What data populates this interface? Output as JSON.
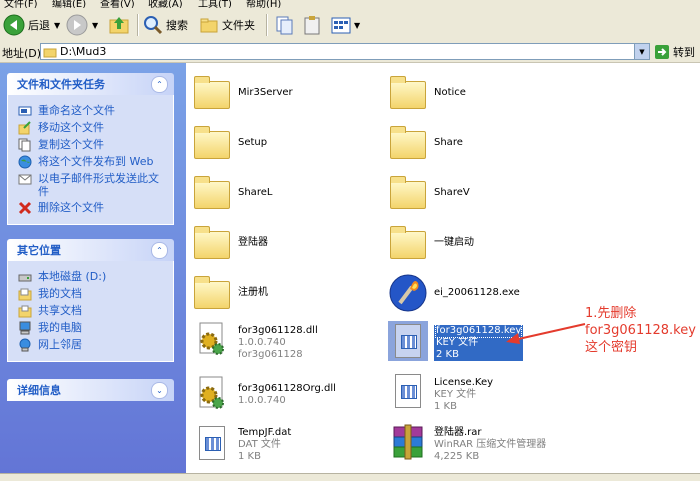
{
  "menubar": {
    "items": [
      "文件(F)",
      "编辑(E)",
      "查看(V)",
      "收藏(A)",
      "工具(T)",
      "帮助(H)"
    ]
  },
  "toolbar": {
    "back_label": "后退",
    "search_label": "搜索",
    "folders_label": "文件夹"
  },
  "address": {
    "label": "地址(D)",
    "value": "D:\\Mud3",
    "go_label": "转到"
  },
  "sidebar": {
    "tasks": {
      "title": "文件和文件夹任务",
      "items": [
        "重命名这个文件",
        "移动这个文件",
        "复制这个文件",
        "将这个文件发布到 Web",
        "以电子邮件形式发送此文件",
        "删除这个文件"
      ]
    },
    "places": {
      "title": "其它位置",
      "items": [
        "本地磁盘 (D:)",
        "我的文档",
        "共享文档",
        "我的电脑",
        "网上邻居"
      ]
    },
    "details": {
      "title": "详细信息"
    }
  },
  "files": [
    {
      "name": "Mir3Server",
      "type": "folder"
    },
    {
      "name": "Notice",
      "type": "folder"
    },
    {
      "name": "Setup",
      "type": "folder"
    },
    {
      "name": "Share",
      "type": "folder"
    },
    {
      "name": "ShareL",
      "type": "folder"
    },
    {
      "name": "ShareV",
      "type": "folder"
    },
    {
      "name": "登陆器",
      "type": "folder"
    },
    {
      "name": "一键启动",
      "type": "folder"
    },
    {
      "name": "注册机",
      "type": "folder"
    },
    {
      "name": "ei_20061128.exe",
      "type": "exe"
    },
    {
      "name": "for3g061128.dll",
      "line2": "1.0.0.740",
      "line3": "for3g061128",
      "type": "dll"
    },
    {
      "name": "for3g061128.key",
      "line2": "KEY 文件",
      "line3": "2 KB",
      "type": "key",
      "selected": true
    },
    {
      "name": "for3g061128Org.dll",
      "line2": "1.0.0.740",
      "type": "dll"
    },
    {
      "name": "License.Key",
      "line2": "KEY 文件",
      "line3": "1 KB",
      "type": "key"
    },
    {
      "name": "TempJF.dat",
      "line2": "DAT 文件",
      "line3": "1 KB",
      "type": "dat"
    },
    {
      "name": "登陆器.rar",
      "line2": "WinRAR 压缩文件管理器",
      "line3": "4,225 KB",
      "type": "rar"
    }
  ],
  "annotation": {
    "lines": [
      "1.先删除",
      "for3g061128.key",
      "这个密钥"
    ],
    "color": "#e43b2d"
  },
  "colors": {
    "sidebar_top": "#7ba2e7",
    "sidebar_bottom": "#6375d6",
    "selection": "#316ac5",
    "link": "#215dc6"
  }
}
